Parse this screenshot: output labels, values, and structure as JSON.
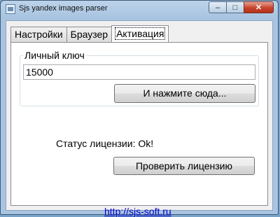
{
  "window": {
    "title": "Sjs yandex images parser",
    "caption_buttons": {
      "minimize": "–",
      "maximize": "□",
      "close": "✕"
    }
  },
  "tabs": [
    {
      "label": "Настройки",
      "active": false
    },
    {
      "label": "Браузер",
      "active": false
    },
    {
      "label": "Активация",
      "active": true
    }
  ],
  "activation": {
    "group_label": "Личный ключ",
    "key_value": "15000",
    "press_button": "И нажмите сюда...",
    "status_text": "Статус лицензии: Ok!",
    "check_button": "Проверить лицензию",
    "link_text": "http://sjs-soft.ru"
  }
}
